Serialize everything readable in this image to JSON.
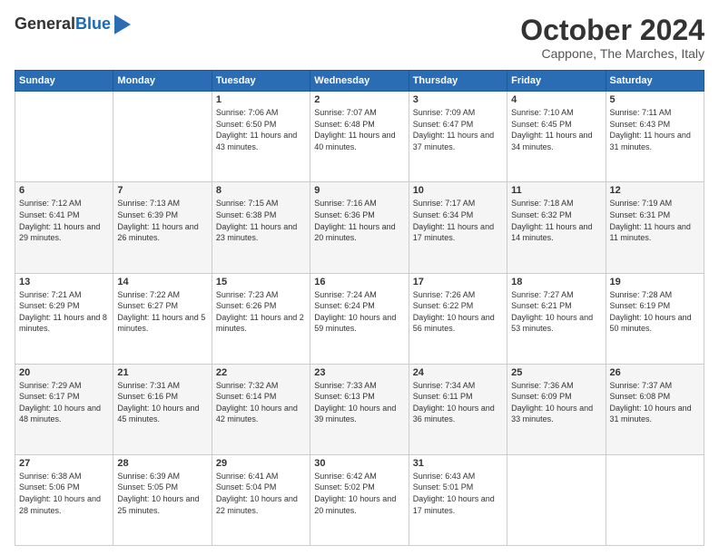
{
  "logo": {
    "general": "General",
    "blue": "Blue"
  },
  "header": {
    "month": "October 2024",
    "location": "Cappone, The Marches, Italy"
  },
  "weekdays": [
    "Sunday",
    "Monday",
    "Tuesday",
    "Wednesday",
    "Thursday",
    "Friday",
    "Saturday"
  ],
  "weeks": [
    [
      null,
      null,
      {
        "day": 1,
        "sunrise": "7:06 AM",
        "sunset": "6:50 PM",
        "daylight": "11 hours and 43 minutes."
      },
      {
        "day": 2,
        "sunrise": "7:07 AM",
        "sunset": "6:48 PM",
        "daylight": "11 hours and 40 minutes."
      },
      {
        "day": 3,
        "sunrise": "7:09 AM",
        "sunset": "6:47 PM",
        "daylight": "11 hours and 37 minutes."
      },
      {
        "day": 4,
        "sunrise": "7:10 AM",
        "sunset": "6:45 PM",
        "daylight": "11 hours and 34 minutes."
      },
      {
        "day": 5,
        "sunrise": "7:11 AM",
        "sunset": "6:43 PM",
        "daylight": "11 hours and 31 minutes."
      }
    ],
    [
      {
        "day": 6,
        "sunrise": "7:12 AM",
        "sunset": "6:41 PM",
        "daylight": "11 hours and 29 minutes."
      },
      {
        "day": 7,
        "sunrise": "7:13 AM",
        "sunset": "6:39 PM",
        "daylight": "11 hours and 26 minutes."
      },
      {
        "day": 8,
        "sunrise": "7:15 AM",
        "sunset": "6:38 PM",
        "daylight": "11 hours and 23 minutes."
      },
      {
        "day": 9,
        "sunrise": "7:16 AM",
        "sunset": "6:36 PM",
        "daylight": "11 hours and 20 minutes."
      },
      {
        "day": 10,
        "sunrise": "7:17 AM",
        "sunset": "6:34 PM",
        "daylight": "11 hours and 17 minutes."
      },
      {
        "day": 11,
        "sunrise": "7:18 AM",
        "sunset": "6:32 PM",
        "daylight": "11 hours and 14 minutes."
      },
      {
        "day": 12,
        "sunrise": "7:19 AM",
        "sunset": "6:31 PM",
        "daylight": "11 hours and 11 minutes."
      }
    ],
    [
      {
        "day": 13,
        "sunrise": "7:21 AM",
        "sunset": "6:29 PM",
        "daylight": "11 hours and 8 minutes."
      },
      {
        "day": 14,
        "sunrise": "7:22 AM",
        "sunset": "6:27 PM",
        "daylight": "11 hours and 5 minutes."
      },
      {
        "day": 15,
        "sunrise": "7:23 AM",
        "sunset": "6:26 PM",
        "daylight": "11 hours and 2 minutes."
      },
      {
        "day": 16,
        "sunrise": "7:24 AM",
        "sunset": "6:24 PM",
        "daylight": "10 hours and 59 minutes."
      },
      {
        "day": 17,
        "sunrise": "7:26 AM",
        "sunset": "6:22 PM",
        "daylight": "10 hours and 56 minutes."
      },
      {
        "day": 18,
        "sunrise": "7:27 AM",
        "sunset": "6:21 PM",
        "daylight": "10 hours and 53 minutes."
      },
      {
        "day": 19,
        "sunrise": "7:28 AM",
        "sunset": "6:19 PM",
        "daylight": "10 hours and 50 minutes."
      }
    ],
    [
      {
        "day": 20,
        "sunrise": "7:29 AM",
        "sunset": "6:17 PM",
        "daylight": "10 hours and 48 minutes."
      },
      {
        "day": 21,
        "sunrise": "7:31 AM",
        "sunset": "6:16 PM",
        "daylight": "10 hours and 45 minutes."
      },
      {
        "day": 22,
        "sunrise": "7:32 AM",
        "sunset": "6:14 PM",
        "daylight": "10 hours and 42 minutes."
      },
      {
        "day": 23,
        "sunrise": "7:33 AM",
        "sunset": "6:13 PM",
        "daylight": "10 hours and 39 minutes."
      },
      {
        "day": 24,
        "sunrise": "7:34 AM",
        "sunset": "6:11 PM",
        "daylight": "10 hours and 36 minutes."
      },
      {
        "day": 25,
        "sunrise": "7:36 AM",
        "sunset": "6:09 PM",
        "daylight": "10 hours and 33 minutes."
      },
      {
        "day": 26,
        "sunrise": "7:37 AM",
        "sunset": "6:08 PM",
        "daylight": "10 hours and 31 minutes."
      }
    ],
    [
      {
        "day": 27,
        "sunrise": "6:38 AM",
        "sunset": "5:06 PM",
        "daylight": "10 hours and 28 minutes."
      },
      {
        "day": 28,
        "sunrise": "6:39 AM",
        "sunset": "5:05 PM",
        "daylight": "10 hours and 25 minutes."
      },
      {
        "day": 29,
        "sunrise": "6:41 AM",
        "sunset": "5:04 PM",
        "daylight": "10 hours and 22 minutes."
      },
      {
        "day": 30,
        "sunrise": "6:42 AM",
        "sunset": "5:02 PM",
        "daylight": "10 hours and 20 minutes."
      },
      {
        "day": 31,
        "sunrise": "6:43 AM",
        "sunset": "5:01 PM",
        "daylight": "10 hours and 17 minutes."
      },
      null,
      null
    ]
  ]
}
